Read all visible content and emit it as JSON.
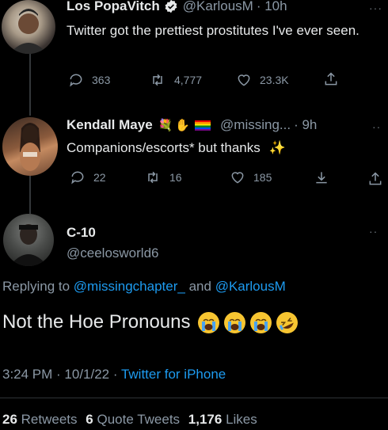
{
  "tweet1": {
    "name": "Los PopaVitch",
    "handle": "@KarlousM",
    "time": "· 10h",
    "text": "Twitter got the prettiest prostitutes I've ever seen.",
    "replies": "363",
    "retweets": "4,777",
    "likes": "23.3K"
  },
  "tweet2": {
    "name": "Kendall Maye",
    "handle": "@missing...",
    "time": "· 9h",
    "text": "Companions/escorts* but thanks",
    "replies": "22",
    "retweets": "16",
    "likes": "185"
  },
  "tweet3": {
    "name": "C-10",
    "handle": "@ceelosworld6",
    "replying_prefix": "Replying to",
    "reply_user1": "@missingchapter_",
    "reply_and": "and",
    "reply_user2": "@KarlousM",
    "text": "Not the Hoe Pronouns",
    "timestamp": "3:24 PM · 10/1/22 ·",
    "source": "Twitter for iPhone",
    "retweet_count": "26",
    "retweet_label": "Retweets",
    "quote_count": "6",
    "quote_label": "Quote Tweets",
    "like_count": "1,176",
    "like_label": "Likes"
  }
}
